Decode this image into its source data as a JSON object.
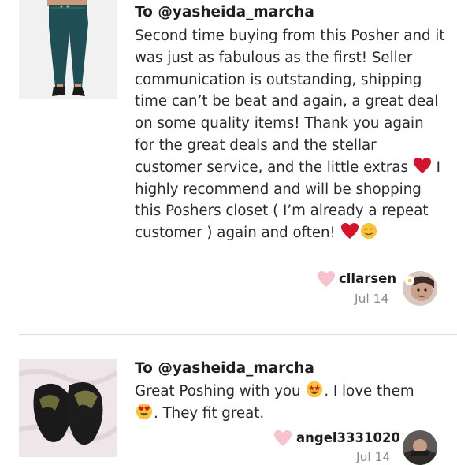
{
  "comments": [
    {
      "to_line": "To @yasheida_marcha",
      "text_before_heart": "Second time buying from this Posher and it was just as fabulous as the first! Seller communication is outstanding, shipping time can’t be beat and again, a great deal on some quality items! Thank you again for the great deals and the stellar customer service, and the little extras ",
      "text_middle": " I highly recommend and will be shopping this Poshers closet ( I’m already a repeat customer ) again and often! ",
      "emojis": [
        "red-heart",
        "red-heart",
        "smiling-face"
      ],
      "username": "cllarsen",
      "date": "Jul 14",
      "thumbnail": "green-skinny-jeans"
    },
    {
      "to_line": "To @yasheida_marcha",
      "text_part1": "Great Poshing with you ",
      "text_part2": ". I love them ",
      "text_part3": ". They fit great.",
      "emojis": [
        "star-struck-face",
        "heart-eyes-face"
      ],
      "username": "angel3331020",
      "date": "Jul 14",
      "thumbnail": "black-gold-thong-sandals"
    }
  ],
  "colors": {
    "like_heart": "#f6c3cc",
    "divider": "#dcdcdc",
    "emoji_heart": "#d3142b",
    "emoji_face": "#f8c239"
  }
}
